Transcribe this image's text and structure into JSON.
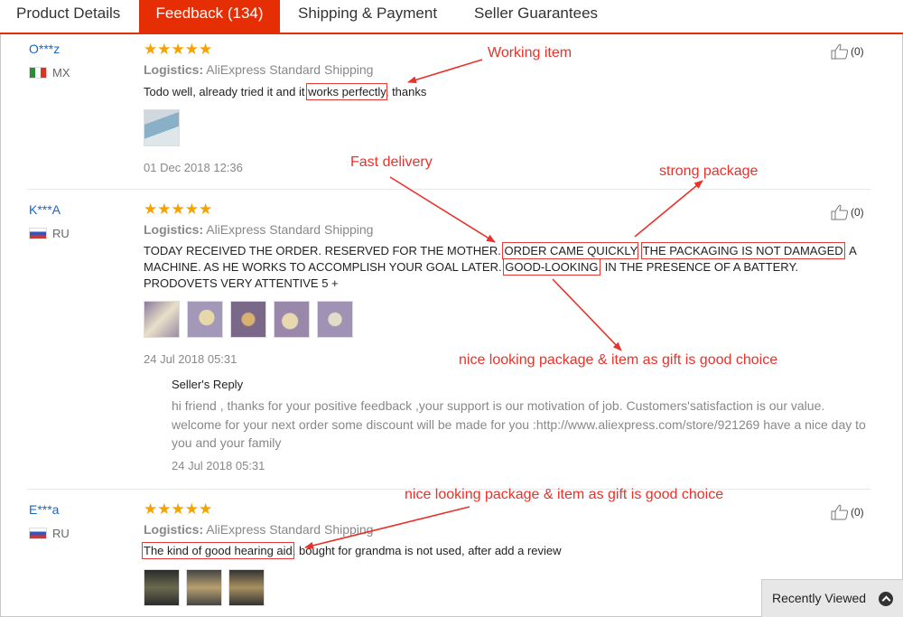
{
  "tabs": [
    {
      "label": "Product Details"
    },
    {
      "label": "Feedback (134)"
    },
    {
      "label": "Shipping & Payment"
    },
    {
      "label": "Seller Guarantees"
    }
  ],
  "active_tab": "Feedback (134)",
  "reviews": [
    {
      "name": "O***z",
      "country": "MX",
      "stars": "★★★★★",
      "logistics_label": "Logistics:",
      "logistics_value": "AliExpress Standard Shipping",
      "text_pre": "Todo well, already tried it and it ",
      "text_hl": "works perfectly",
      "text_post": ", thanks",
      "date": "01 Dec 2018 12:36",
      "helpful": "(0)"
    },
    {
      "name": "K***A",
      "country": "RU",
      "stars": "★★★★★",
      "logistics_label": "Logistics:",
      "logistics_value": "AliExpress Standard Shipping",
      "text_a": "TODAY RECEIVED THE ORDER. RESERVED FOR THE MOTHER. ",
      "text_hl1": "ORDER CAME QUICKLY",
      "text_b": ", ",
      "text_hl2": "THE PACKAGING IS NOT DAMAGED",
      "text_c": ", A MACHINE. AS HE WORKS TO ACCOMPLISH YOUR GOAL LATER. ",
      "text_hl3": "GOOD-LOOKING",
      "text_d": ". IN THE PRESENCE OF A BATTERY. PRODOVETS VERY ATTENTIVE 5 +",
      "date": "24 Jul 2018 05:31",
      "helpful": "(0)",
      "reply_title": "Seller's Reply",
      "reply_text": "hi friend , thanks for your positive feedback ,your support is our motivation of job. Customers'satisfaction is our value. welcome for your next order some discount will be made for you :http://www.aliexpress.com/store/921269 have a nice day to you and your family",
      "reply_date": "24 Jul 2018 05:31"
    },
    {
      "name": "E***a",
      "country": "RU",
      "stars": "★★★★★",
      "logistics_label": "Logistics:",
      "logistics_value": "AliExpress Standard Shipping",
      "text_hl": "The kind of good hearing aid",
      "text_post": ", bought for grandma is not used, after add a review",
      "helpful": "(0)"
    }
  ],
  "annotations": {
    "working_item": "Working item",
    "fast_delivery": "Fast delivery",
    "strong_package": "strong package",
    "nice_looking_1": "nice looking package & item as gift is good choice",
    "nice_looking_2": "nice looking package & item as gift is good choice"
  },
  "recently_viewed": "Recently Viewed",
  "colors": {
    "accent": "#e62e04",
    "star": "#f5a300",
    "link": "#1a66c8",
    "annotation": "#e8322b"
  }
}
